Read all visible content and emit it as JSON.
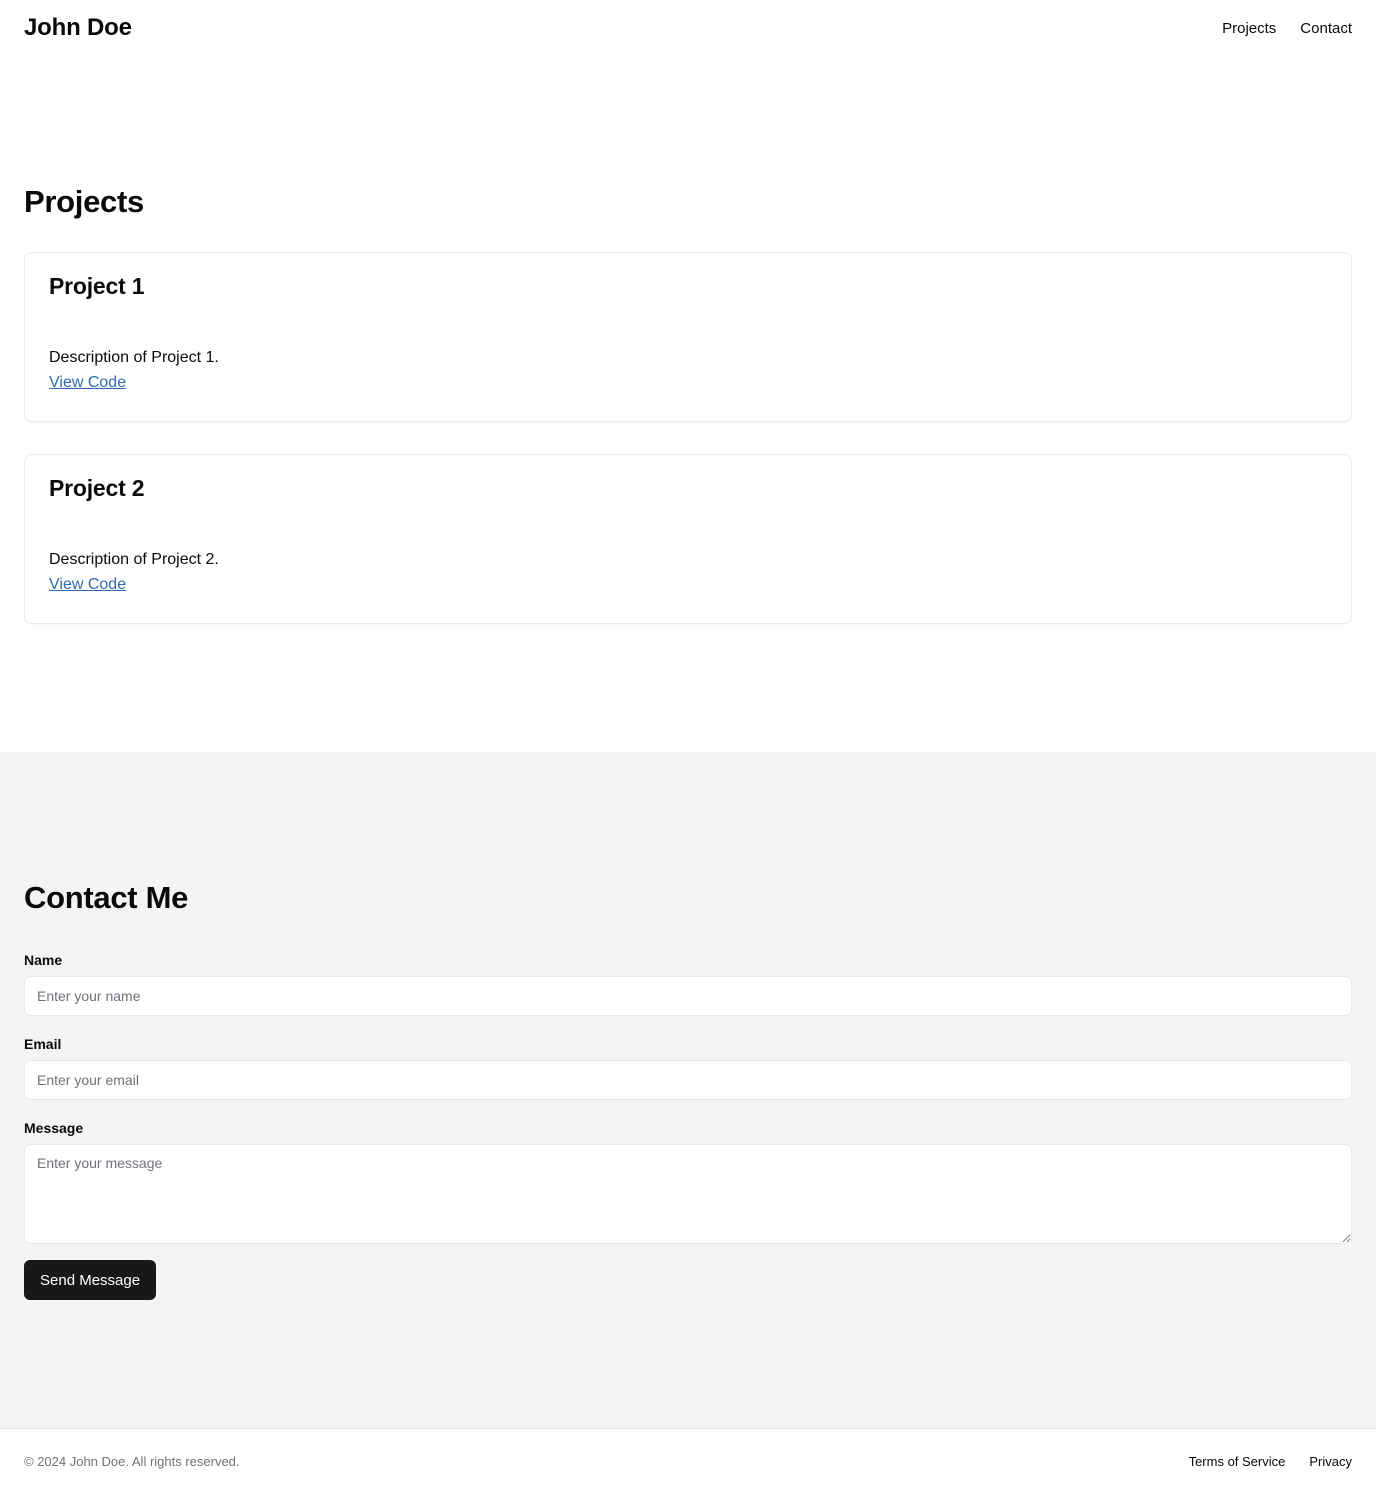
{
  "header": {
    "brand": "John Doe",
    "nav": [
      {
        "label": "Projects"
      },
      {
        "label": "Contact"
      }
    ]
  },
  "projects": {
    "title": "Projects",
    "items": [
      {
        "title": "Project 1",
        "description": "Description of Project 1.",
        "link_label": "View Code"
      },
      {
        "title": "Project 2",
        "description": "Description of Project 2.",
        "link_label": "View Code"
      }
    ]
  },
  "contact": {
    "title": "Contact Me",
    "name_label": "Name",
    "name_placeholder": "Enter your name",
    "email_label": "Email",
    "email_placeholder": "Enter your email",
    "message_label": "Message",
    "message_placeholder": "Enter your message",
    "submit_label": "Send Message"
  },
  "footer": {
    "copyright": "© 2024 John Doe. All rights reserved.",
    "links": [
      {
        "label": "Terms of Service"
      },
      {
        "label": "Privacy"
      }
    ]
  },
  "colors": {
    "link": "#2f6ab0",
    "button_bg": "#18181b",
    "contact_bg": "#f3f4f6",
    "border": "#e5e7eb"
  }
}
